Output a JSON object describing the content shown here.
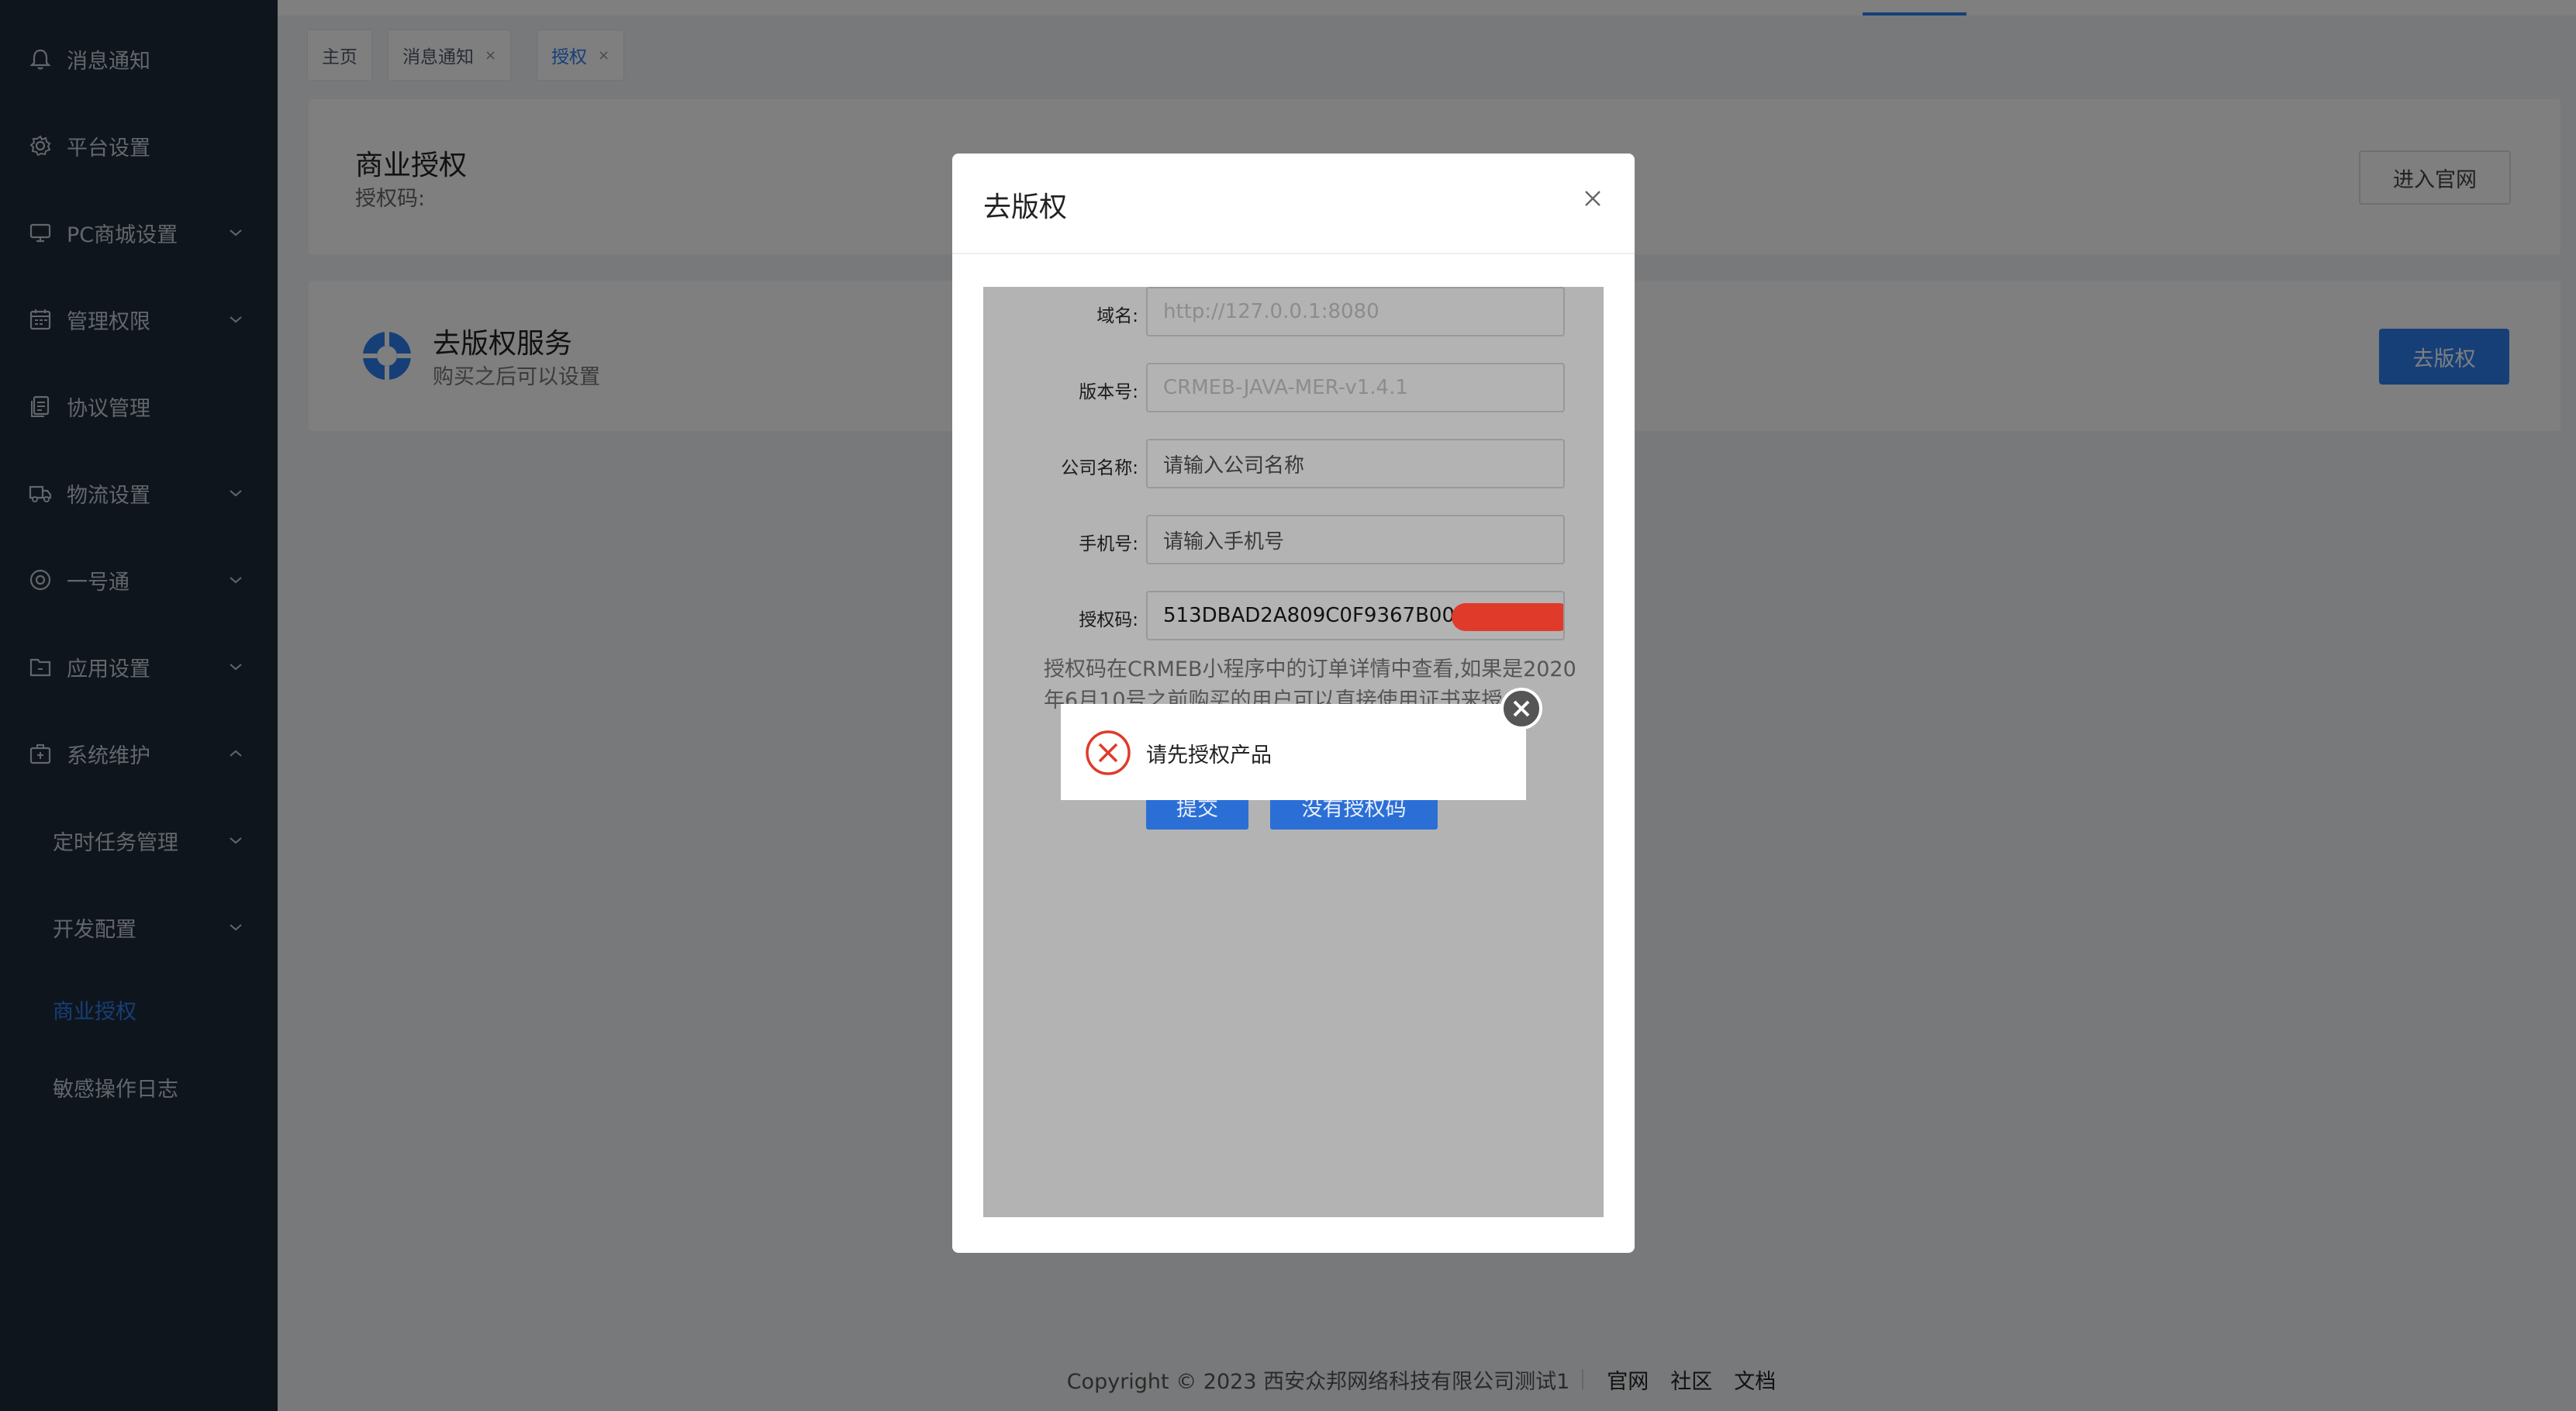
{
  "sidebar": {
    "items": [
      {
        "label": "消息通知",
        "icon": "bell-icon"
      },
      {
        "label": "平台设置",
        "icon": "gear-icon"
      },
      {
        "label": "PC商城设置",
        "icon": "monitor-icon"
      },
      {
        "label": "管理权限",
        "icon": "calendar-icon"
      },
      {
        "label": "协议管理",
        "icon": "document-icon"
      },
      {
        "label": "物流设置",
        "icon": "truck-icon"
      },
      {
        "label": "一号通",
        "icon": "lifebuoy-icon"
      },
      {
        "label": "应用设置",
        "icon": "folder-icon"
      },
      {
        "label": "系统维护",
        "icon": "toolbox-icon"
      }
    ],
    "sub_items": [
      {
        "label": "定时任务管理"
      },
      {
        "label": "开发配置"
      },
      {
        "label": "商业授权"
      },
      {
        "label": "敏感操作日志"
      }
    ]
  },
  "tags": [
    {
      "label": "主页"
    },
    {
      "label": "消息通知",
      "close": "×"
    },
    {
      "label": "授权",
      "close": "×"
    }
  ],
  "license_card": {
    "title": "商业授权",
    "code_label": "授权码:",
    "website_button": "进入官网"
  },
  "copyright_card": {
    "title": "去版权服务",
    "subtitle": "购买之后可以设置",
    "button": "去版权"
  },
  "dialog": {
    "title": "去版权",
    "fields": [
      {
        "label": "域名:",
        "value": "http://127.0.0.1:8080",
        "state": "disabled"
      },
      {
        "label": "版本号:",
        "value": "CRMEB-JAVA-MER-v1.4.1",
        "state": "disabled"
      },
      {
        "label": "公司名称:",
        "value": "请输入公司名称",
        "state": "placeholder"
      },
      {
        "label": "手机号:",
        "value": "请输入手机号",
        "state": "placeholder"
      },
      {
        "label": "授权码:",
        "value": "513DBAD2A809C0F9367B00",
        "state": "value"
      }
    ],
    "hint": "授权码在CRMEB小程序中的订单详情中查看,如果是2020年6月10号之前购买的用户可以直接使用证书来授",
    "submit_button": "提交",
    "no_code_button": "没有授权码"
  },
  "toast": {
    "message": "请先授权产品"
  },
  "footer": {
    "copyright": "Copyright © 2023 西安众邦网络科技有限公司测试1",
    "links": [
      "官网",
      "社区",
      "文档"
    ]
  },
  "colors": {
    "sidebar_bg": "#1f2a3a",
    "accent": "#2d7ff0",
    "error": "#e03a2b"
  }
}
